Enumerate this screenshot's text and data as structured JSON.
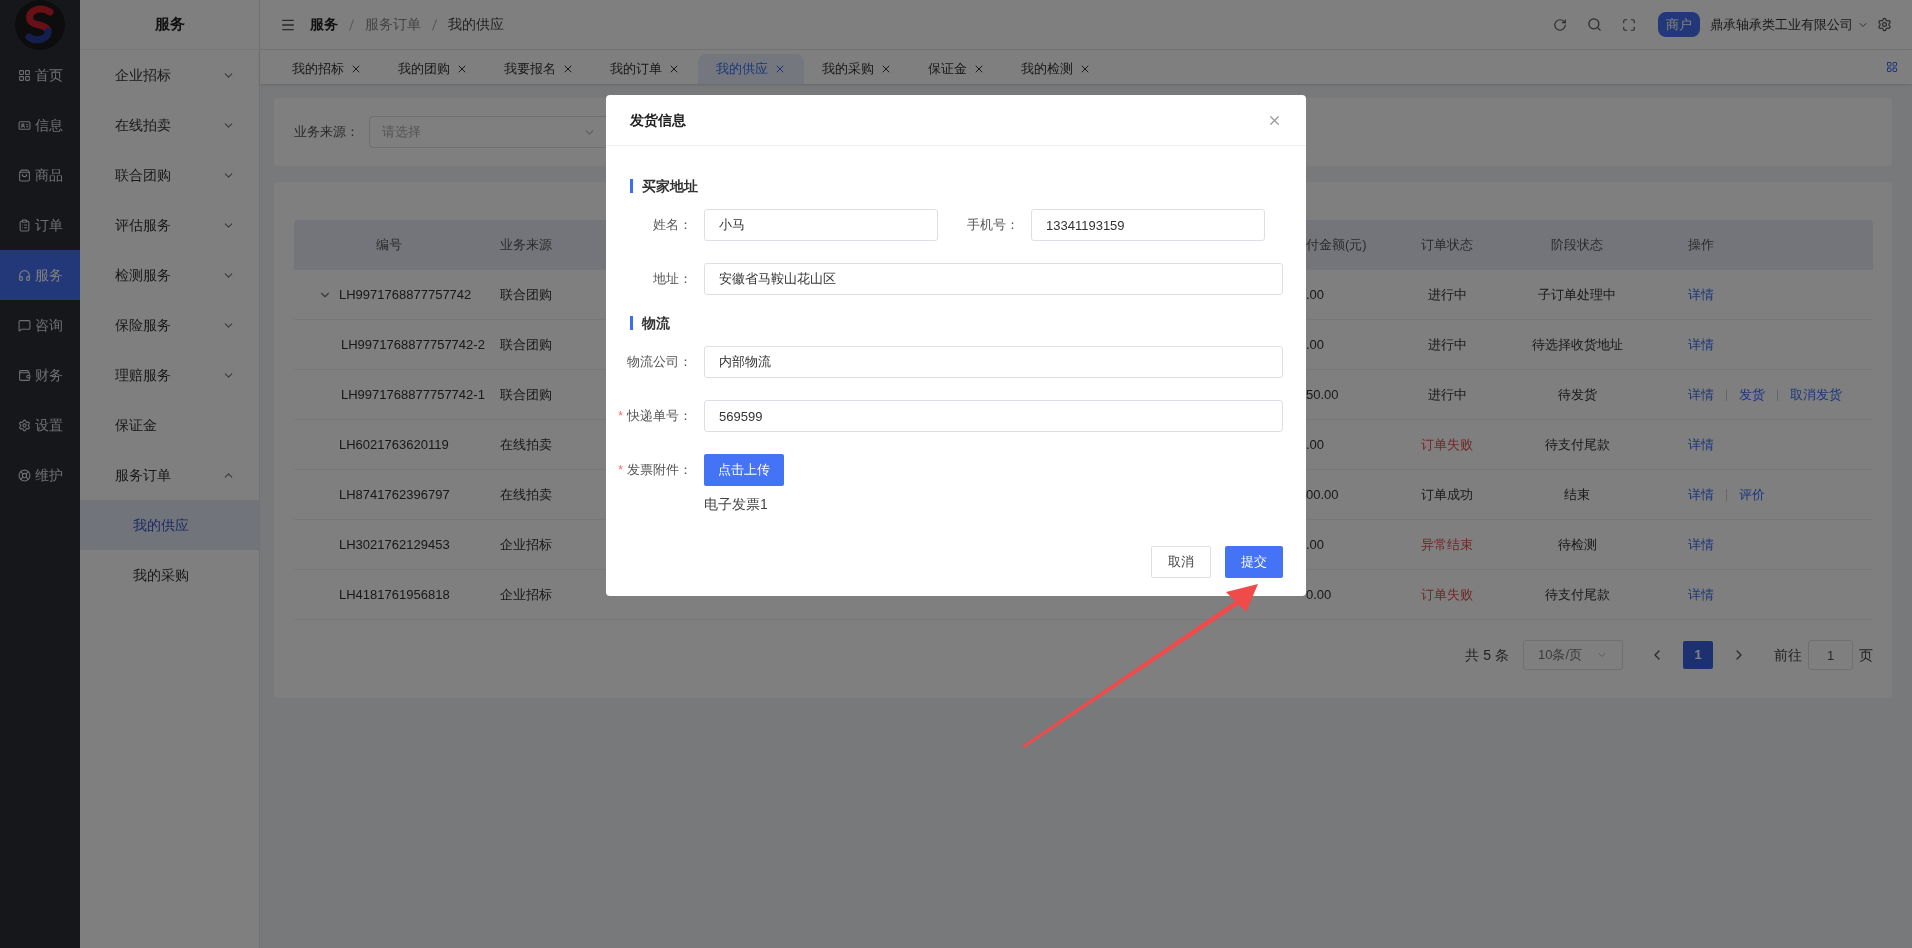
{
  "app_rail": {
    "items": [
      {
        "label": "首页",
        "selected": false
      },
      {
        "label": "信息",
        "selected": false
      },
      {
        "label": "商品",
        "selected": false
      },
      {
        "label": "订单",
        "selected": false
      },
      {
        "label": "服务",
        "selected": true
      },
      {
        "label": "咨询",
        "selected": false
      },
      {
        "label": "财务",
        "selected": false
      },
      {
        "label": "设置",
        "selected": false
      },
      {
        "label": "维护",
        "selected": false
      }
    ]
  },
  "sidebar": {
    "title": "服务",
    "items": [
      {
        "label": "企业招标",
        "kind": "group",
        "expanded": false
      },
      {
        "label": "在线拍卖",
        "kind": "group",
        "expanded": false
      },
      {
        "label": "联合团购",
        "kind": "group",
        "expanded": false
      },
      {
        "label": "评估服务",
        "kind": "group",
        "expanded": false
      },
      {
        "label": "检测服务",
        "kind": "group",
        "expanded": false
      },
      {
        "label": "保险服务",
        "kind": "group",
        "expanded": false
      },
      {
        "label": "理赔服务",
        "kind": "group",
        "expanded": false
      },
      {
        "label": "保证金",
        "kind": "link"
      },
      {
        "label": "服务订单",
        "kind": "group",
        "expanded": true,
        "children": [
          {
            "label": "我的供应",
            "selected": true
          },
          {
            "label": "我的采购",
            "selected": false
          }
        ]
      }
    ]
  },
  "header": {
    "breadcrumb": [
      "服务",
      "服务订单",
      "我的供应"
    ],
    "badge": "商户",
    "company": "鼎承轴承类工业有限公司"
  },
  "tabs": [
    {
      "label": "我的招标",
      "selected": false
    },
    {
      "label": "我的团购",
      "selected": false
    },
    {
      "label": "我要报名",
      "selected": false
    },
    {
      "label": "我的订单",
      "selected": false
    },
    {
      "label": "我的供应",
      "selected": true
    },
    {
      "label": "我的采购",
      "selected": false
    },
    {
      "label": "保证金",
      "selected": false
    },
    {
      "label": "我的检测",
      "selected": false
    }
  ],
  "filter": {
    "label": "业务来源：",
    "placeholder": "请选择"
  },
  "table": {
    "columns": [
      "编号",
      "业务来源",
      "付金额(元)",
      "订单状态",
      "阶段状态",
      "操作"
    ],
    "rows": [
      {
        "code": "LH9971768877757742",
        "source": "联合团购",
        "amount": ".00",
        "status": "进行中",
        "status_alert": false,
        "stage": "子订单处理中",
        "actions": [
          "详情"
        ],
        "expanded": true,
        "children": [
          {
            "code": "LH9971768877757742-2",
            "source": "联合团购",
            "amount": ".00",
            "status": "进行中",
            "status_alert": false,
            "stage": "待选择收货地址",
            "actions": [
              "详情"
            ]
          },
          {
            "code": "LH9971768877757742-1",
            "source": "联合团购",
            "amount": "50.00",
            "status": "进行中",
            "status_alert": false,
            "stage": "待发货",
            "actions": [
              "详情",
              "发货",
              "取消发货"
            ]
          }
        ]
      },
      {
        "code": "LH6021763620119",
        "source": "在线拍卖",
        "amount": ".00",
        "status": "订单失败",
        "status_alert": true,
        "stage": "待支付尾款",
        "actions": [
          "详情"
        ]
      },
      {
        "code": "LH8741762396797",
        "source": "在线拍卖",
        "amount": "00.00",
        "status": "订单成功",
        "status_alert": false,
        "stage": "结束",
        "actions": [
          "详情",
          "评价"
        ]
      },
      {
        "code": "LH3021762129453",
        "source": "企业招标",
        "amount": ".00",
        "status": "异常结束",
        "status_alert": true,
        "stage": "待检测",
        "actions": [
          "详情"
        ]
      },
      {
        "code": "LH4181761956818",
        "source": "企业招标",
        "amount": "0.00",
        "status": "订单失败",
        "status_alert": true,
        "stage": "待支付尾款",
        "actions": [
          "详情"
        ]
      }
    ]
  },
  "pagination": {
    "total": "共 5 条",
    "page_size": "10条/页",
    "pages": [
      {
        "label": "1",
        "selected": true
      }
    ],
    "goto_label": "前往",
    "goto_value": "1",
    "goto_unit": "页"
  },
  "dialog": {
    "title": "发货信息",
    "sections": [
      {
        "title": "买家地址",
        "rows": [
          [
            {
              "kind": "input",
              "label": "姓名：",
              "value": "小马"
            },
            {
              "kind": "input",
              "label": "手机号：",
              "value": "13341193159"
            }
          ],
          [
            {
              "kind": "input",
              "label": "地址：",
              "value": "安徽省马鞍山花山区"
            }
          ]
        ]
      },
      {
        "title": "物流",
        "rows": [
          [
            {
              "kind": "input",
              "label": "物流公司：",
              "value": "内部物流"
            }
          ],
          [
            {
              "kind": "input",
              "label": "快递单号：",
              "value": "569599",
              "required_mark": "*"
            }
          ],
          [
            {
              "kind": "upload",
              "label": "发票附件：",
              "button": "点击上传",
              "files": [
                "电子发票1"
              ],
              "required_mark": "*"
            }
          ]
        ]
      }
    ],
    "buttons": [
      {
        "label": "取消",
        "kind": "default"
      },
      {
        "label": "提交",
        "kind": "primary"
      }
    ]
  }
}
